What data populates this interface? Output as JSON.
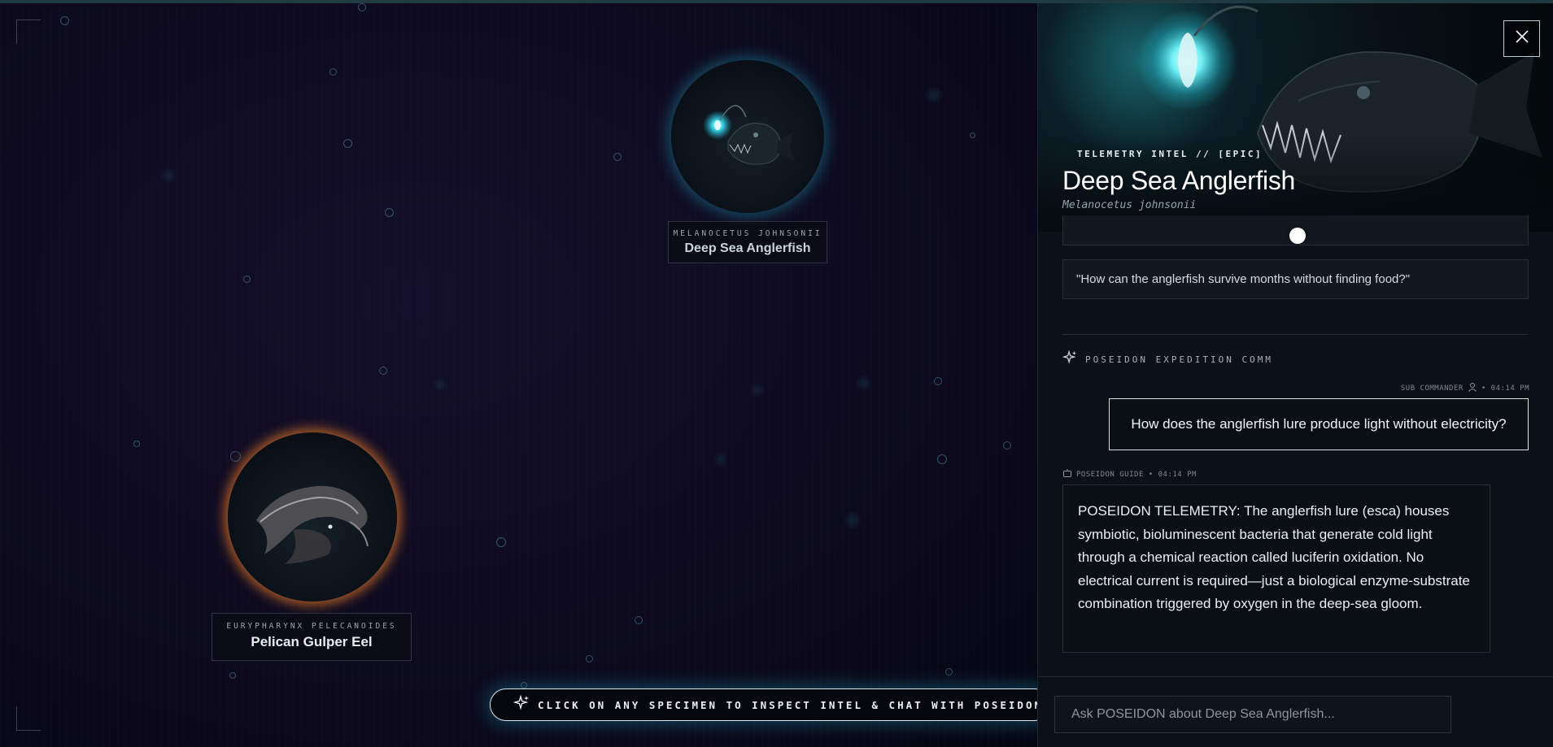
{
  "stage": {
    "hint_text": "CLICK ON ANY SPECIMEN TO INSPECT INTEL & CHAT WITH POSEIDON AI",
    "specimens": [
      {
        "scientific": "MELANOCETUS JOHNSONII",
        "common": "Deep Sea Anglerfish",
        "glow_color": "#1ea0be"
      },
      {
        "scientific": "EURYPHARYNX PELECANOIDES",
        "common": "Pelican Gulper Eel",
        "glow_color": "#e6782a"
      }
    ]
  },
  "panel": {
    "tag": "TELEMETRY INTEL // [EPIC]",
    "title": "Deep Sea Anglerfish",
    "latin": "Melanocetus johnsonii",
    "suggested_questions": [
      "\"How can the anglerfish survive months without finding food?\""
    ],
    "comm_label": "POSEIDON EXPEDITION COMM",
    "user_meta": "SUB COMMANDER",
    "user_time": "• 04:14 PM",
    "user_message": "How does the anglerfish lure produce light without electricity?",
    "bot_meta": "POSEIDON GUIDE • 04:14 PM",
    "bot_message": "POSEIDON TELEMETRY: The anglerfish lure (esca) houses symbiotic, bioluminescent bacteria that generate cold light through a chemical reaction called luciferin oxidation. No electrical current is required—just a biological enzyme-substrate combination triggered by oxygen in the deep-sea gloom.",
    "input_placeholder": "Ask POSEIDON about Deep Sea Anglerfish..."
  },
  "colors": {
    "accent": "#1ea0be",
    "eel_glow": "#e6782a",
    "panel_bg": "#0c1117"
  }
}
